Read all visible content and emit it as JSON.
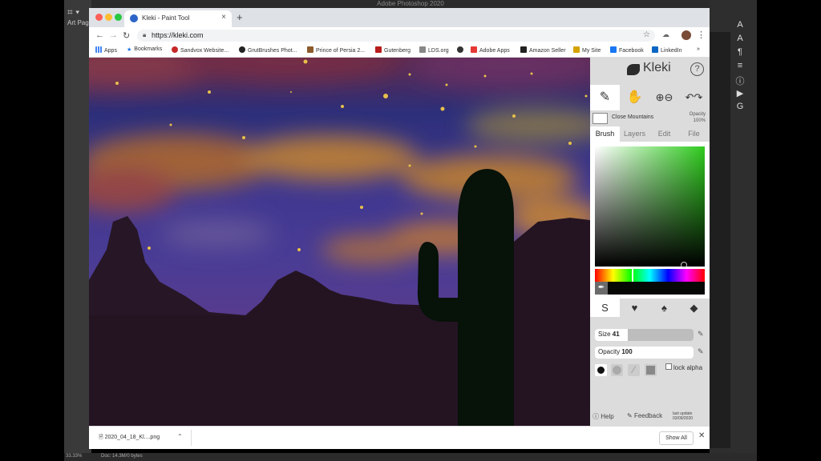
{
  "photoshop": {
    "title": "Adobe Photoshop 2020",
    "art_page": "Art Page",
    "zoom": "33.33%",
    "doc_info": "Doc: 14.3M/0 bytes"
  },
  "browser": {
    "tab_title": "Kleki - Paint Tool",
    "url": "https://kleki.com",
    "bookmarks": [
      "Apps",
      "Bookmarks",
      "Sandvox Website...",
      "GrutBrushes Phot...",
      "Prince of Persia 2...",
      "Gutenberg",
      "LDS.org",
      "Adobe Apps",
      "Amazon Seller",
      "My Site",
      "Facebook",
      "LinkedIn"
    ],
    "bookmarks_overflow": "»"
  },
  "kleki": {
    "logo": "Kleki",
    "help_glyph": "?",
    "layer_name": "Close Mountains",
    "layer_opacity_label": "Opacity",
    "layer_opacity_value": "100%",
    "tabs": [
      "Brush",
      "Layers",
      "Edit",
      "File"
    ],
    "active_tab": "Brush",
    "color": "#060806",
    "hue_color": "#2fcb1e",
    "size_label": "Size",
    "size_value": "41",
    "size_fraction": 0.33,
    "opacity_label": "Opacity",
    "opacity_value": "100",
    "opacity_fraction": 1.0,
    "lock_alpha_label": "lock alpha",
    "footer": {
      "help": "Help",
      "feedback": "Feedback",
      "last_update_label": "last update",
      "last_update_date": "03/09/2020"
    }
  },
  "downloads": {
    "file_name": "2020_04_18_Kl....png",
    "show_all": "Show All"
  }
}
